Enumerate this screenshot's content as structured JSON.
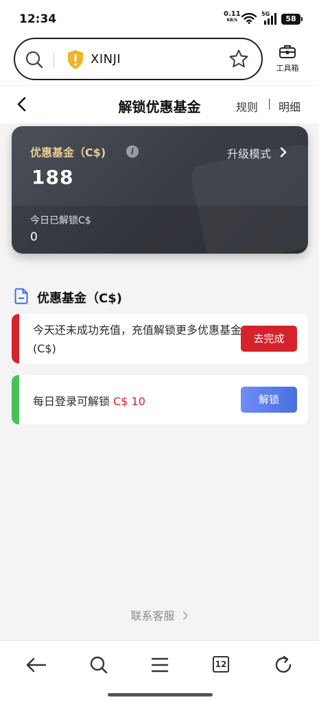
{
  "status_bar": {
    "time": "12:34",
    "network_speed": "0.11",
    "network_unit": "KB/S",
    "cell_type": "5G",
    "battery": "58"
  },
  "browser": {
    "query": "XINJI",
    "toolbox_label": "工具箱"
  },
  "header": {
    "title": "解锁优惠基金",
    "rules": "规则",
    "separator": "|",
    "detail": "明细"
  },
  "fund_card": {
    "title": "优惠基金（C$)",
    "info_glyph": "i",
    "upgrade_label": "升级模式",
    "amount": "188",
    "today_label": "今日已解锁C$",
    "today_value": "0"
  },
  "section": {
    "title": "优惠基金（C$)"
  },
  "tasks": [
    {
      "text": "今天还未成功充值，充值解锁更多优惠基金 (C$)",
      "button": "去完成",
      "accent": "#d5222b"
    },
    {
      "text": "每日登录可解锁",
      "reward": "C$ 10",
      "button": "解锁",
      "accent": "#45c254"
    }
  ],
  "contact_label": "联系客服",
  "bottom_nav": {
    "tabs_count": "12",
    "icons": [
      "back-arrow-icon",
      "search-icon",
      "menu-icon",
      "tabs-icon",
      "refresh-icon"
    ]
  },
  "colors": {
    "accent_red": "#d5222b",
    "accent_green": "#45c254",
    "accent_blue": "#4a6fe0",
    "gold": "#e8cd95"
  }
}
